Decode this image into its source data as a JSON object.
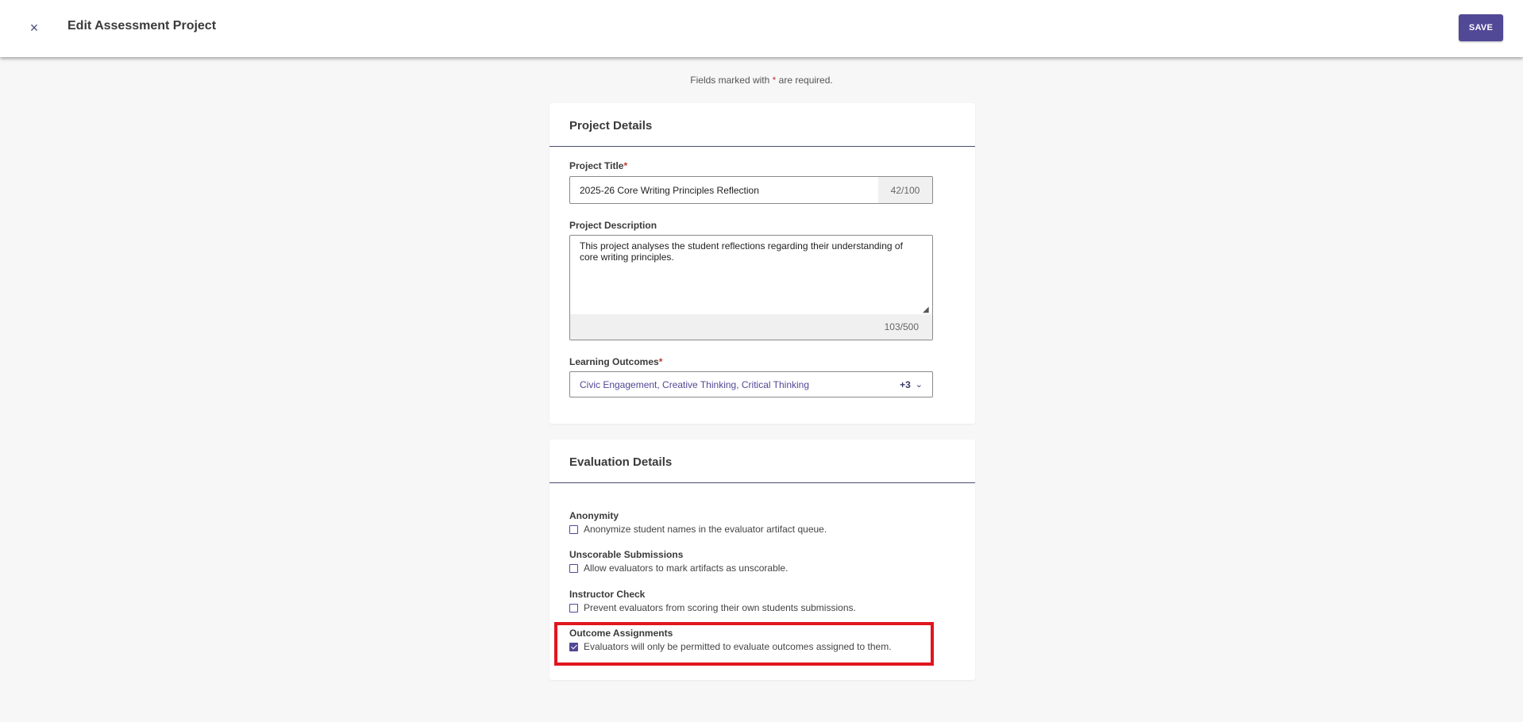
{
  "header": {
    "close_icon": "×",
    "title": "Edit Assessment Project",
    "save_label": "SAVE"
  },
  "required_note": {
    "prefix": "Fields marked with",
    "star": "*",
    "suffix": "are required."
  },
  "project_details": {
    "heading": "Project Details",
    "title_label": "Project Title",
    "title_value": "2025-26 Core Writing Principles Reflection",
    "title_counter": "42/100",
    "description_label": "Project Description",
    "description_value": "This project analyses the student reflections regarding their understanding of core writing principles.",
    "description_counter": "103/500",
    "outcomes_label": "Learning Outcomes",
    "outcomes_value": "Civic Engagement, Creative Thinking, Critical Thinking",
    "outcomes_more": "+3",
    "required_star": "*"
  },
  "evaluation_details": {
    "heading": "Evaluation Details",
    "options": [
      {
        "title": "Anonymity",
        "text": "Anonymize student names in the evaluator artifact queue.",
        "checked": false
      },
      {
        "title": "Unscorable Submissions",
        "text": "Allow evaluators to mark artifacts as unscorable.",
        "checked": false
      },
      {
        "title": "Instructor Check",
        "text": "Prevent evaluators from scoring their own students submissions.",
        "checked": false
      },
      {
        "title": "Outcome Assignments",
        "text": "Evaluators will only be permitted to evaluate outcomes assigned to them.",
        "checked": true
      }
    ]
  },
  "colors": {
    "accent": "#514896",
    "highlight": "#e0161e",
    "required": "#c0392b"
  }
}
